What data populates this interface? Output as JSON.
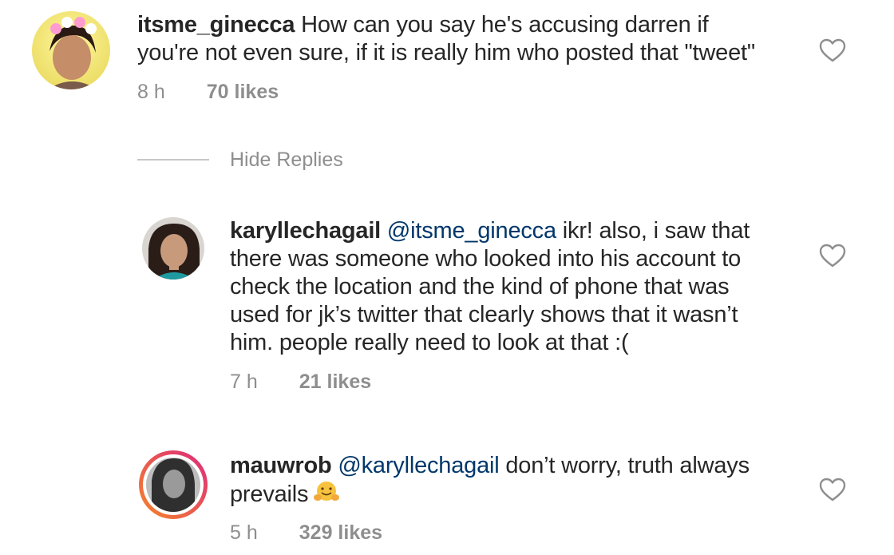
{
  "comments": [
    {
      "username": "itsme_ginecca",
      "text_line1": "How can you say he's accusing darren if",
      "text_line2": "you're not even sure, if it is really him who posted that \"tweet\"",
      "time": "8 h",
      "likes": "70 likes"
    },
    {
      "username": "karyllechagail",
      "mention": "@itsme_ginecca",
      "text_line1": "ikr! also, i saw that",
      "text_line2": "there was someone who looked into his account to",
      "text_line3": "check the location and the kind of phone that was",
      "text_line4": "used for jk’s twitter that clearly shows that it wasn’t",
      "text_line5": "him. people really need to look at that :(",
      "time": "7 h",
      "likes": "21 likes"
    },
    {
      "username": "mauwrob",
      "mention": "@karyllechagail",
      "text_line1": "don’t worry, truth always",
      "text_line2": "prevails",
      "emoji": "hugging-face-icon",
      "time": "5 h",
      "likes": "329 likes"
    }
  ],
  "hide_replies_label": "Hide Replies",
  "colors": {
    "text": "#262626",
    "meta": "#8e8e8e",
    "mention": "#00376b",
    "story_ring_start": "#f58529",
    "story_ring_end": "#dd2a7b"
  }
}
